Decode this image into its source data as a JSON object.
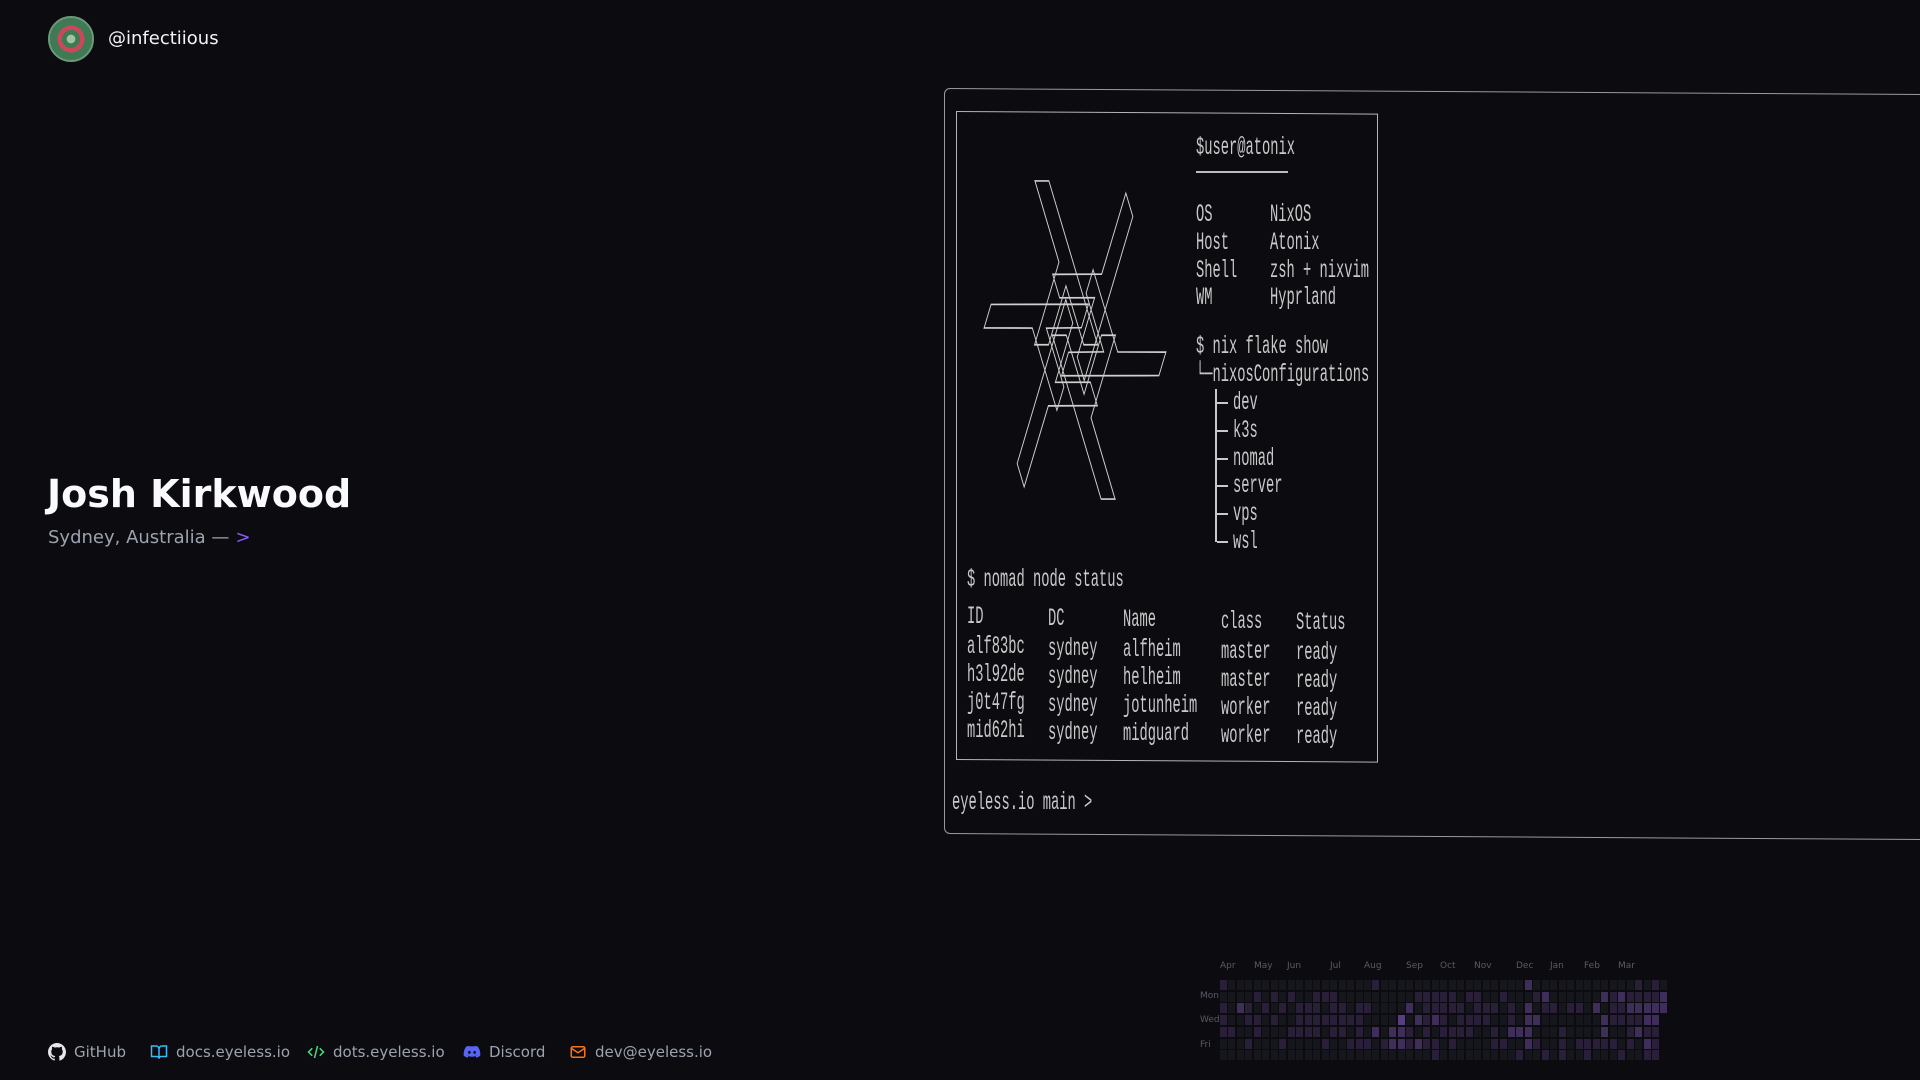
{
  "profile": {
    "username": "@infectiious",
    "name": "Josh Kirkwood",
    "location": "Sydney, Australia —",
    "arrow": ">"
  },
  "footer_links": [
    {
      "label": "GitHub",
      "icon": "github-icon",
      "color": "#e5e7eb"
    },
    {
      "label": "docs.eyeless.io",
      "icon": "book-icon",
      "color": "#38bdf8"
    },
    {
      "label": "dots.eyeless.io",
      "icon": "code-icon",
      "color": "#4ade80"
    },
    {
      "label": "Discord",
      "icon": "discord-icon",
      "color": "#5865f2"
    },
    {
      "label": "dev@eyeless.io",
      "icon": "mail-icon",
      "color": "#f97316"
    }
  ],
  "terminal": {
    "user_host": "$user@atonix",
    "info": [
      {
        "key": "OS",
        "value": "NixOS"
      },
      {
        "key": "Host",
        "value": "Atonix"
      },
      {
        "key": "Shell",
        "value": "zsh + nixvim"
      },
      {
        "key": "WM",
        "value": "Hyprland"
      }
    ],
    "flake_cmd": "$ nix flake show",
    "flake_root": "└─nixosConfigurations",
    "configs": [
      "dev",
      "k3s",
      "nomad",
      "server",
      "vps",
      "wsl"
    ],
    "nomad_cmd": "$ nomad node status",
    "table_headers": [
      "ID",
      "DC",
      "Name",
      "class",
      "Status"
    ],
    "table_rows": [
      [
        "alf83bc",
        "sydney",
        "alfheim",
        "master",
        "ready"
      ],
      [
        "h3l92de",
        "sydney",
        "helheim",
        "master",
        "ready"
      ],
      [
        "j0t47fg",
        "sydney",
        "jotunheim",
        "worker",
        "ready"
      ],
      [
        "mid62hi",
        "sydney",
        "midguard",
        "worker",
        "ready"
      ]
    ],
    "prompt": "eyeless.io main >"
  },
  "contributions": {
    "months": [
      "Apr",
      "May",
      "Jun",
      "Jul",
      "Aug",
      "Sep",
      "Oct",
      "Nov",
      "Dec",
      "Jan",
      "Feb",
      "Mar"
    ],
    "days": [
      "Mon",
      "Wed",
      "Fri"
    ],
    "level_colors": [
      "#16161d",
      "#2a1f38",
      "#3f2d5a",
      "#573e80"
    ],
    "levels": [
      "10000000000000000010000000000000000020000000000001010",
      "00001010100111000000000111110110010001200000021211112",
      "10210101011101101100002011111011101020110110201122222",
      "1001101001111111100003021210111100102200000002111122-",
      "1100100011110110102022101011110010222000100002001211-",
      "0001000100001001110122121101000011002100101111101021-",
      "0000000000000000000000000100000000010010100100010011-"
    ]
  }
}
